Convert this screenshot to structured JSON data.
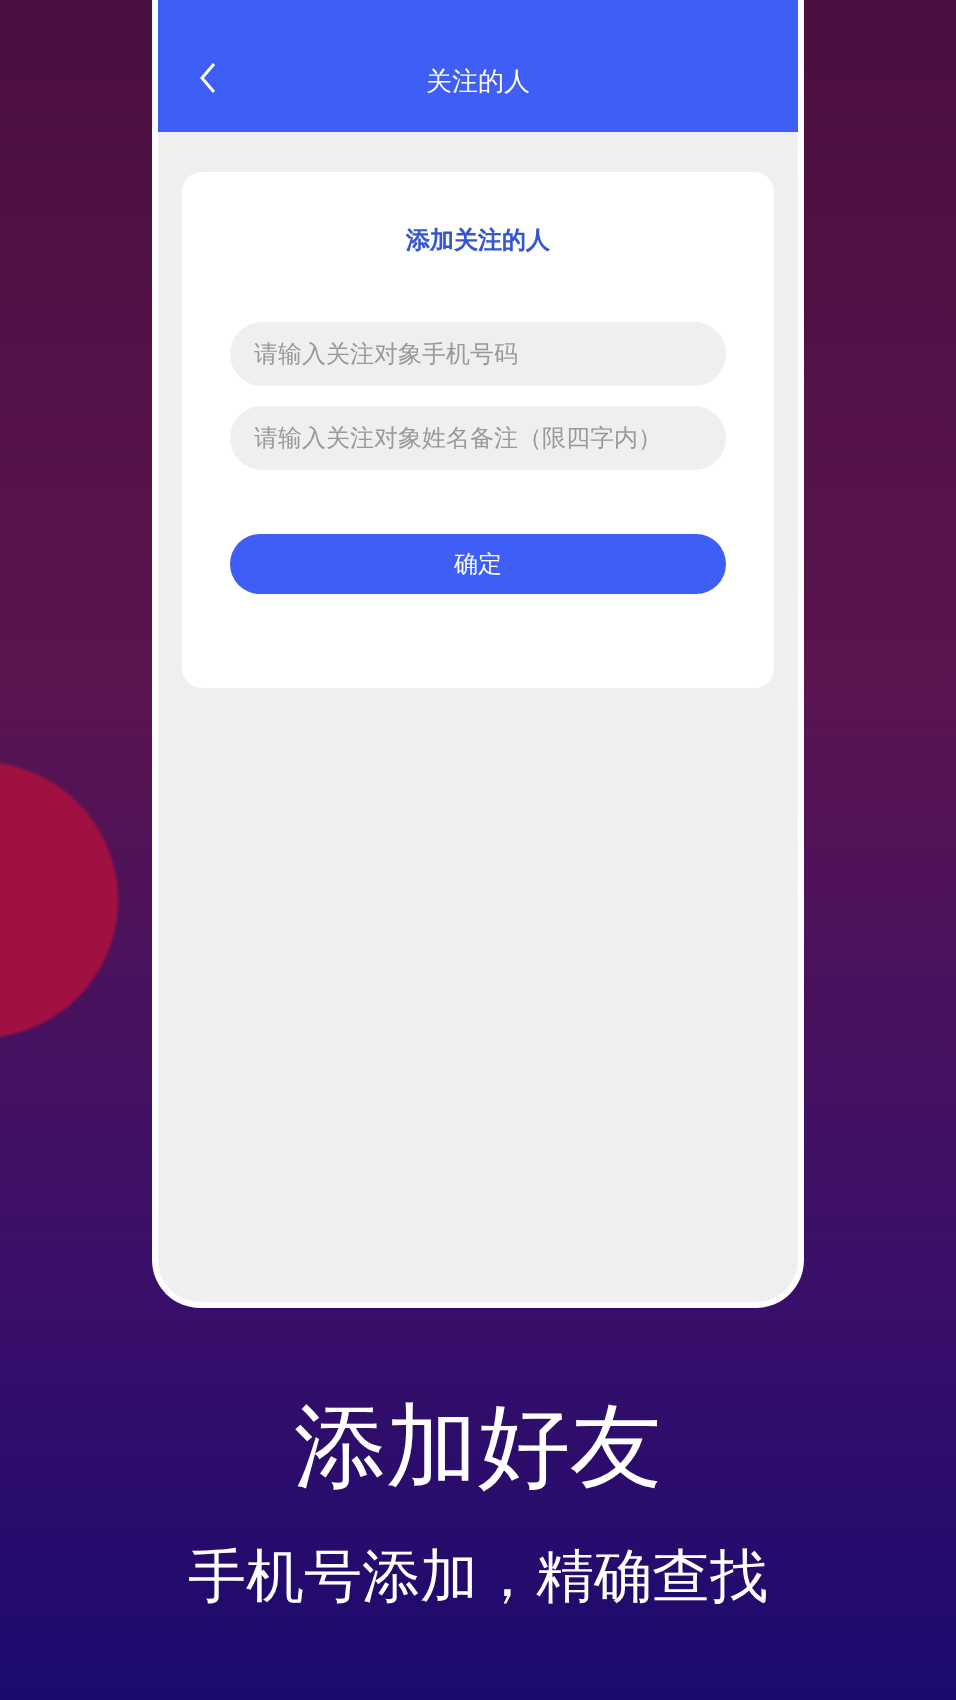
{
  "app_screen": {
    "title": "关注的人",
    "card": {
      "title": "添加关注的人",
      "fields": [
        {
          "placeholder": "请输入关注对象手机号码"
        },
        {
          "placeholder": "请输入关注对象姓名备注（限四字内）"
        }
      ],
      "confirm_button": "确定"
    }
  },
  "caption": {
    "headline": "添加好友",
    "subtitle": "手机号添加，精确查找"
  }
}
